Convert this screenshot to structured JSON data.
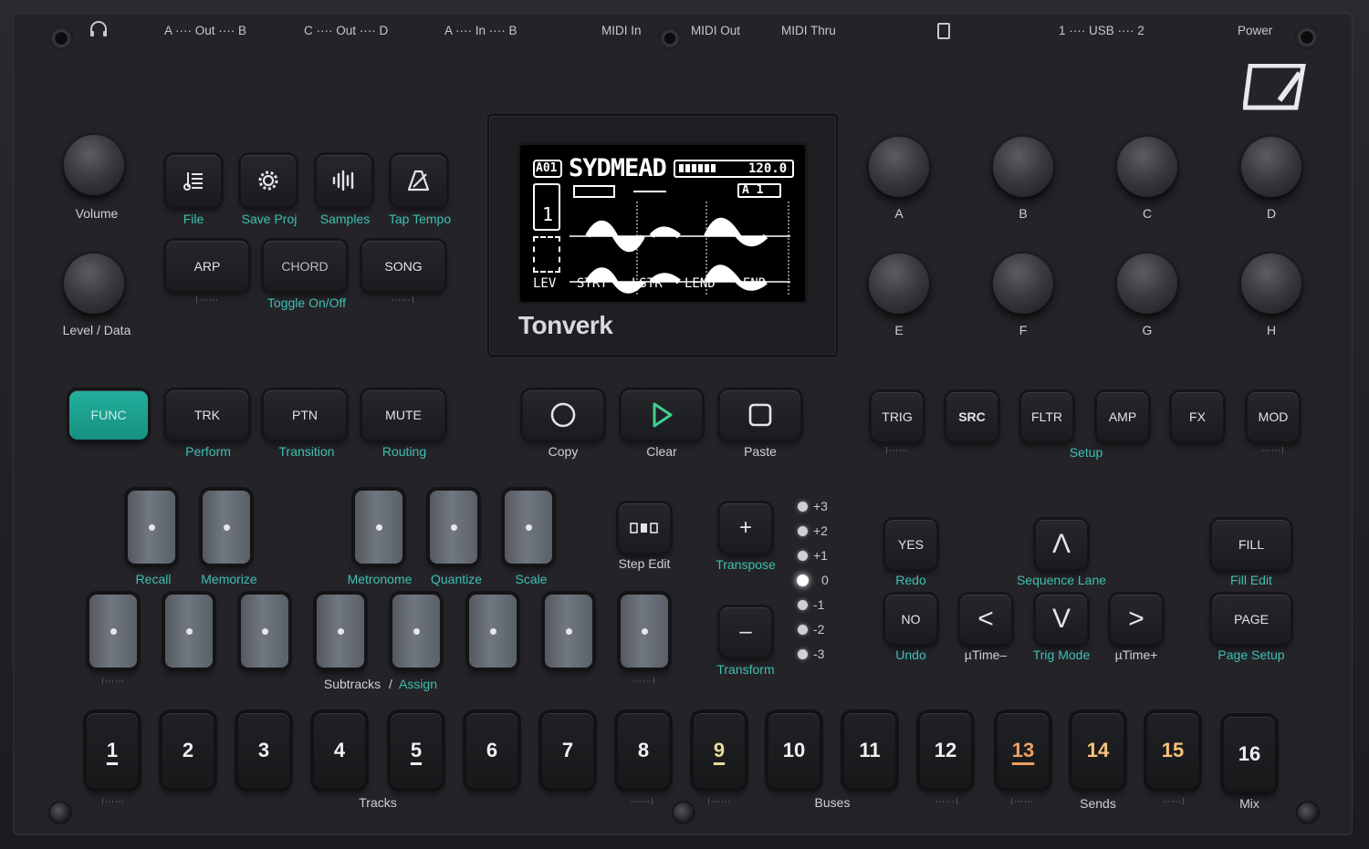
{
  "top_bar": {
    "headphone_icon": "headphones-icon",
    "a_out_b": "A ···· Out ···· B",
    "c_out_d": "C ···· Out ···· D",
    "a_in_b": "A ···· In ···· B",
    "midi_in": "MIDI In",
    "midi_out": "MIDI Out",
    "midi_thru": "MIDI Thru",
    "sd_icon": "sd-card-icon",
    "usb": "1 ···· USB ···· 2",
    "power": "Power"
  },
  "brand": {
    "logo_icon": "elektron-logo-icon",
    "screen_brand": "Tonverk"
  },
  "screen": {
    "pattern": "A01",
    "name": "SYDMEAD",
    "bpm": "120.0",
    "track_num": "1",
    "bank": "A 1",
    "bottom_params": [
      "LEV",
      "STRT",
      "LSTR",
      "LEND",
      "END"
    ]
  },
  "left_knobs": {
    "volume": "Volume",
    "level_data": "Level / Data"
  },
  "icon_keys": [
    {
      "label": "File",
      "icon": "list-icon"
    },
    {
      "label": "Save Proj",
      "icon": "gear-icon"
    },
    {
      "label": "Samples",
      "icon": "waveform-icon"
    },
    {
      "label": "Tap Tempo",
      "icon": "tempo-icon"
    }
  ],
  "mode_keys": {
    "arp": "ARP",
    "chord": "CHORD",
    "song": "SONG",
    "toggle": "Toggle On/Off"
  },
  "func_row": [
    {
      "key": "FUNC",
      "label": ""
    },
    {
      "key": "TRK",
      "label": "Perform"
    },
    {
      "key": "PTN",
      "label": "Transition"
    },
    {
      "key": "MUTE",
      "label": "Routing"
    }
  ],
  "transport": [
    {
      "label": "Copy",
      "icon": "stop-circle-icon"
    },
    {
      "label": "Clear",
      "icon": "play-icon"
    },
    {
      "label": "Paste",
      "icon": "square-icon"
    }
  ],
  "right_knobs": [
    "A",
    "B",
    "C",
    "D",
    "E",
    "F",
    "G",
    "H"
  ],
  "page_keys": {
    "keys": [
      "TRIG",
      "SRC",
      "FLTR",
      "AMP",
      "FX",
      "MOD"
    ],
    "setup": "Setup"
  },
  "pads_top": [
    "Recall",
    "Memorize",
    "Metronome",
    "Quantize",
    "Scale"
  ],
  "pads_bottom_label": {
    "subtracks": "Subtracks",
    "slash": "/",
    "assign": "Assign"
  },
  "step_edit": {
    "label": "Step Edit",
    "icon": "step-edit-icon"
  },
  "transpose": {
    "plus": "+",
    "label": "Transpose",
    "minus": "–",
    "minus_label": "Transform"
  },
  "leds": [
    "+3",
    "+2",
    "+1",
    "0",
    "-1",
    "-2",
    "-3"
  ],
  "right_controls": {
    "yes": "YES",
    "redo": "Redo",
    "no": "NO",
    "undo": "Undo",
    "up": "Λ",
    "sequence_lane": "Sequence Lane",
    "left": "<",
    "utime_minus": "µTime–",
    "down": "V",
    "trig_mode": "Trig Mode",
    "right": ">",
    "utime_plus": "µTime+",
    "fill": "FILL",
    "fill_edit": "Fill Edit",
    "page": "PAGE",
    "page_setup": "Page Setup"
  },
  "steps": [
    "1",
    "2",
    "3",
    "4",
    "5",
    "6",
    "7",
    "8",
    "9",
    "10",
    "11",
    "12",
    "13",
    "14",
    "15",
    "16"
  ],
  "step_groups": {
    "tracks": "Tracks",
    "buses": "Buses",
    "sends": "Sends",
    "mix": "Mix"
  },
  "colors": {
    "teal": "#3fbfb1",
    "func_key": "#1f9f8d",
    "orange_step": "#f0a060",
    "amber_step": "#f7c37a"
  }
}
